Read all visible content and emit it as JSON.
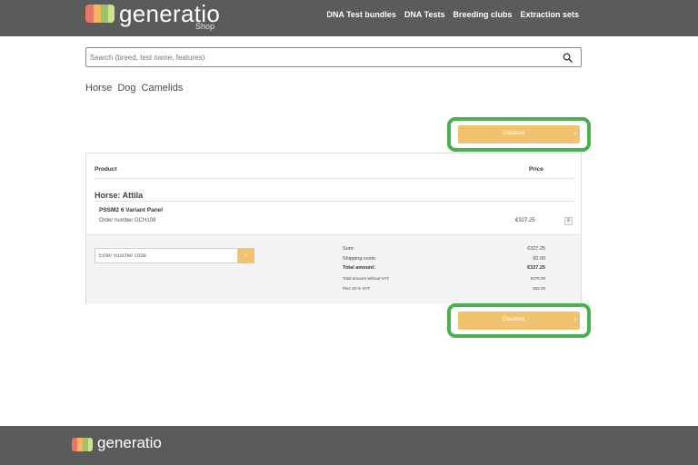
{
  "header": {
    "brand": "generatio",
    "brand_sub": "Shop",
    "logo_colors": [
      "#e8776a",
      "#f4b760",
      "#9cc36a",
      "#cfe38a"
    ],
    "nav": [
      {
        "label": "DNA Test bundles"
      },
      {
        "label": "DNA Tests"
      },
      {
        "label": "Breeding clubs"
      },
      {
        "label": "Extraction sets"
      }
    ]
  },
  "search": {
    "placeholder": "Search (breed, test name, features)",
    "value": "",
    "icon": "search-icon"
  },
  "categories": [
    {
      "label": "Horse"
    },
    {
      "label": "Dog"
    },
    {
      "label": "Camelids"
    }
  ],
  "checkout": {
    "label": "Checkout",
    "icon": "chevron-right-icon",
    "highlight_color": "#4caf50",
    "button_color": "#f2c36f"
  },
  "cart": {
    "col_product": "Product",
    "col_price": "Price",
    "group_title": "Horse: Attila",
    "items": [
      {
        "name": "PSSM2 6 Variant Panel",
        "order": "Order number GCH108",
        "price": "€327.25",
        "remove": "x"
      }
    ],
    "voucher": {
      "placeholder": "Enter voucher code",
      "value": "",
      "button": "›"
    },
    "totals": {
      "sum_label": "Sum:",
      "sum_value": "€327.25",
      "shipping_label": "Shipping costs:",
      "shipping_value": "€0.00",
      "total_label": "Total amount:",
      "total_value": "€327.25",
      "net_label": "Total amount without VAT:",
      "net_value": "€275.00",
      "vat_label": "Plus 19 % VAT:",
      "vat_value": "€52.25"
    }
  },
  "footer": {
    "brand": "generatio"
  }
}
